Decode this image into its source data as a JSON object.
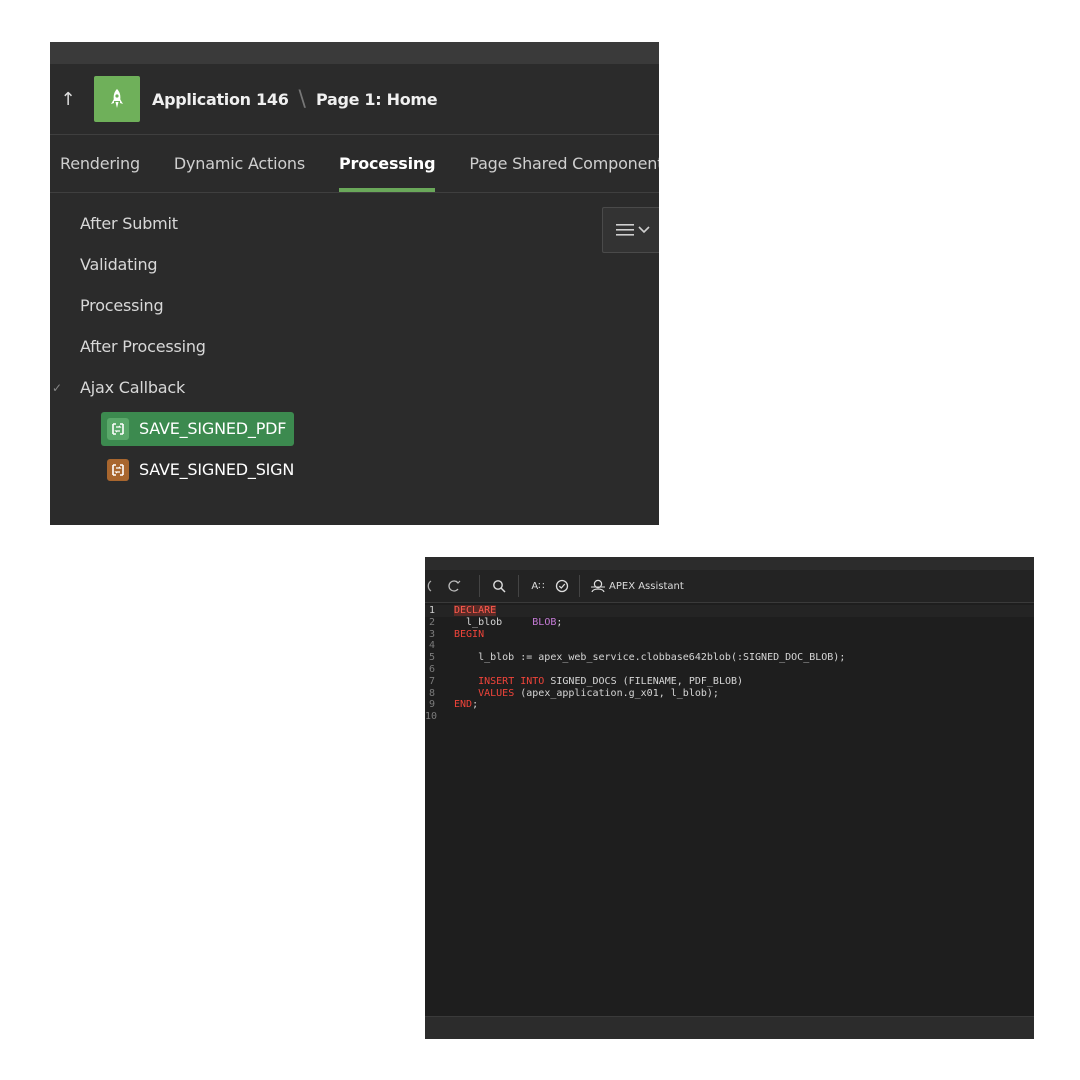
{
  "header": {
    "app_name": "Application 146",
    "separator": "\\",
    "page_name": "Page 1: Home"
  },
  "tabs": [
    {
      "label": "Rendering"
    },
    {
      "label": "Dynamic Actions"
    },
    {
      "label": "Processing",
      "active": true
    },
    {
      "label": "Page Shared Components"
    }
  ],
  "tree": {
    "items": [
      {
        "label": "After Submit"
      },
      {
        "label": "Validating"
      },
      {
        "label": "Processing"
      },
      {
        "label": "After Processing"
      },
      {
        "label": "Ajax Callback",
        "expanded": true
      }
    ],
    "children": [
      {
        "label": "SAVE_SIGNED_PDF",
        "selected": true,
        "icon": "ajax-callback-icon"
      },
      {
        "label": "SAVE_SIGNED_SIGN",
        "selected": false,
        "icon": "ajax-callback-icon"
      }
    ]
  },
  "editor": {
    "assistant_label": "APEX Assistant",
    "lines": [
      {
        "n": "1",
        "text": "DECLARE"
      },
      {
        "n": "2",
        "text": "  l_blob     BLOB;"
      },
      {
        "n": "3",
        "text": "BEGIN"
      },
      {
        "n": "4",
        "text": ""
      },
      {
        "n": "5",
        "text": "    l_blob := apex_web_service.clobbase642blob(:SIGNED_DOC_BLOB);"
      },
      {
        "n": "6",
        "text": ""
      },
      {
        "n": "7",
        "text": "    INSERT INTO SIGNED_DOCS (FILENAME, PDF_BLOB)"
      },
      {
        "n": "8",
        "text": "    VALUES (apex_application.g_x01, l_blob);"
      },
      {
        "n": "9",
        "text": "END;"
      },
      {
        "n": "10",
        "text": ""
      }
    ]
  },
  "colors": {
    "accent_green": "#6aa85a",
    "keyword_red": "#f0443a",
    "type_purple": "#c77cd8"
  }
}
